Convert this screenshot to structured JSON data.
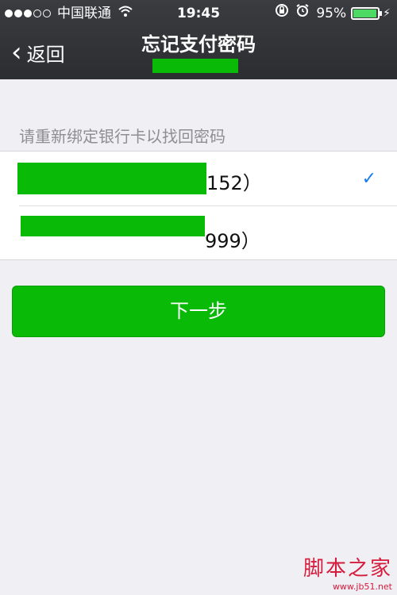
{
  "status_bar": {
    "carrier": "中国联通",
    "time": "19:45",
    "battery_percent": "95%",
    "battery_level": 0.95,
    "signal_bars_filled": 3,
    "signal_bars_total": 5,
    "icons": [
      "wifi-icon",
      "rotation-lock-icon",
      "alarm-icon",
      "charging-bolt-icon"
    ]
  },
  "nav": {
    "back_label": "返回",
    "title": "忘记支付密码"
  },
  "hint": "请重新绑定银行卡以找回密码",
  "cards": [
    {
      "suffix": "152）",
      "selected": true
    },
    {
      "suffix": "999）",
      "selected": false
    }
  ],
  "next_button": {
    "label": "下一步"
  },
  "watermark": {
    "text": "脚本之家",
    "url": "www.jb51.net"
  },
  "colors": {
    "accent_green": "#09bb07",
    "check_blue": "#1a7cf2",
    "nav_bg": "#2b2d31"
  }
}
